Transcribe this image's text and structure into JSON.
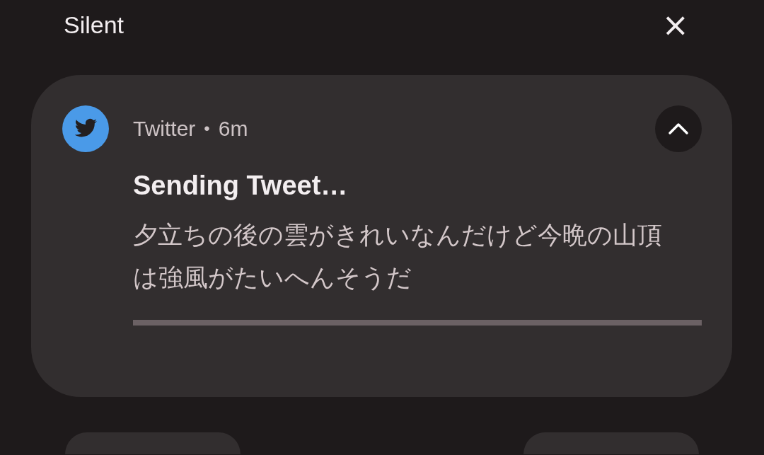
{
  "header": {
    "title": "Silent",
    "close": "×"
  },
  "notification": {
    "app": "Twitter",
    "separator": "•",
    "time": "6m",
    "expanded": true,
    "title": "Sending Tweet…",
    "text": "夕立ちの後の雲がきれいなんだけど今晩の山頂は強風がたいへんそうだ",
    "progress": {
      "level": 0
    }
  }
}
